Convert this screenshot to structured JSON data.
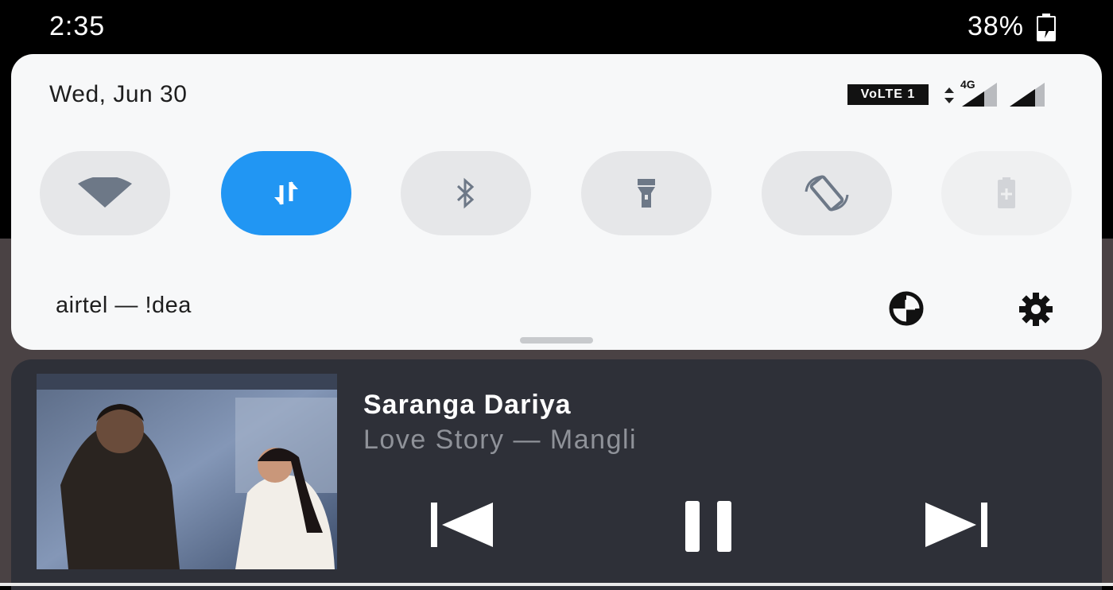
{
  "status_bar": {
    "time": "2:35",
    "battery_percent": "38%",
    "battery_icon": "battery-charging-icon"
  },
  "quick_settings": {
    "date": "Wed, Jun 30",
    "volte_badge": "VoLTE 1",
    "network_type": "4G",
    "tiles": [
      {
        "icon": "wifi-icon",
        "state": "off"
      },
      {
        "icon": "mobile-data-icon",
        "state": "on"
      },
      {
        "icon": "bluetooth-icon",
        "state": "off"
      },
      {
        "icon": "flashlight-icon",
        "state": "off"
      },
      {
        "icon": "auto-rotate-icon",
        "state": "off"
      },
      {
        "icon": "battery-saver-icon",
        "state": "disabled"
      }
    ],
    "carrier": "airtel — !dea",
    "accent_color": "#2196f3"
  },
  "media": {
    "title": "Saranga Dariya",
    "subtitle": "Love Story — Mangli",
    "controls": [
      "previous-icon",
      "pause-icon",
      "next-icon"
    ],
    "background_color": "#2e3038"
  }
}
